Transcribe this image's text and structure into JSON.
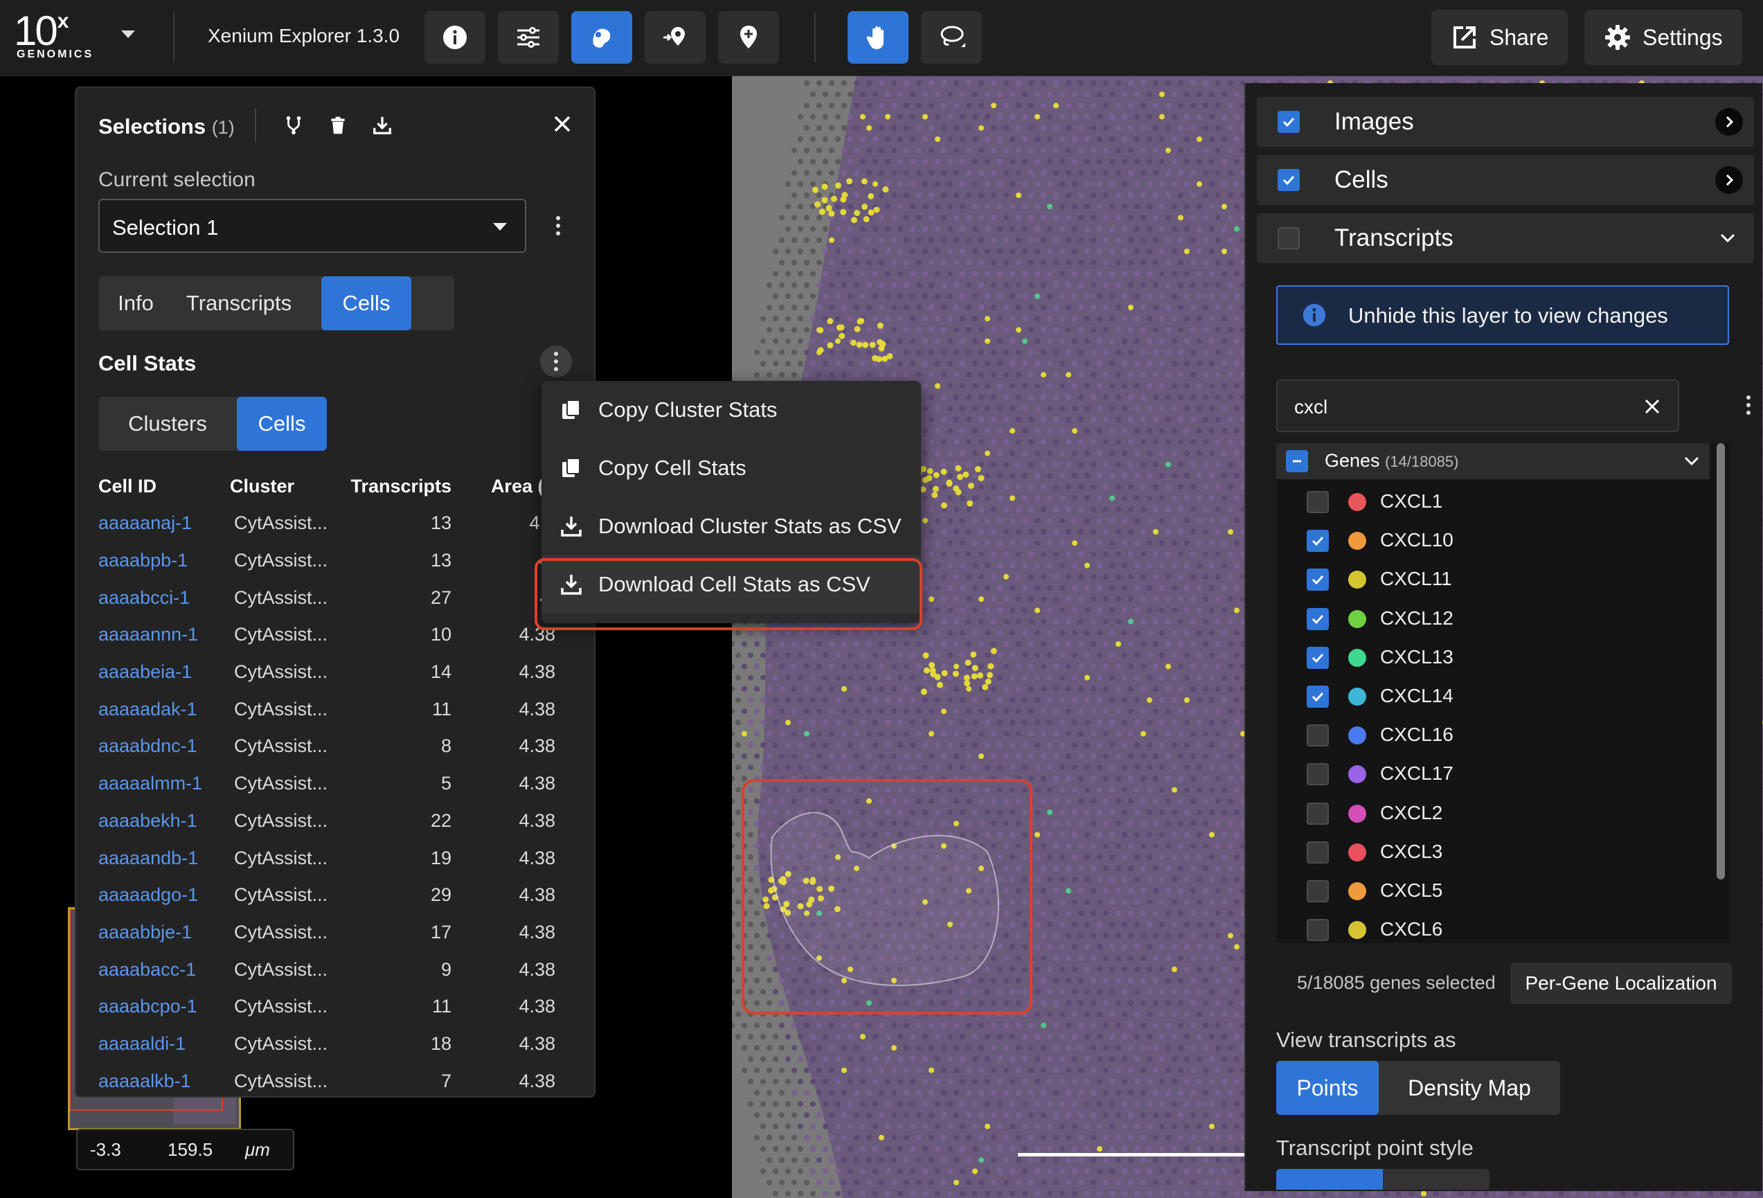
{
  "app": {
    "logo_main": "10",
    "logo_sup": "x",
    "logo_sub": "GENOMICS",
    "title": "Xenium Explorer 1.3.0",
    "share_label": "Share",
    "settings_label": "Settings"
  },
  "colors": {
    "accent": "#2f75d8",
    "highlight": "#d9412b",
    "link": "#5a96ee",
    "map_bg": "#7a7a7a"
  },
  "selections": {
    "title": "Selections",
    "count": "(1)",
    "current_label": "Current selection",
    "current_value": "Selection 1",
    "tabs": [
      {
        "label": "Info",
        "active": false
      },
      {
        "label": "Transcripts",
        "active": false
      },
      {
        "label": "Cells",
        "active": true
      }
    ],
    "cell_stats_title": "Cell Stats",
    "stat_tabs": [
      {
        "label": "Clusters",
        "active": false
      },
      {
        "label": "Cells",
        "active": true
      }
    ],
    "columns": [
      "Cell ID",
      "Cluster",
      "Transcripts",
      "Area (μ"
    ],
    "rows": [
      {
        "id": "aaaaanaj-1",
        "cluster": "CytAssist...",
        "transcripts": "13",
        "area": "4.3"
      },
      {
        "id": "aaaabpb-1",
        "cluster": "CytAssist...",
        "transcripts": "13",
        "area": "4."
      },
      {
        "id": "aaaabcci-1",
        "cluster": "CytAssist...",
        "transcripts": "27",
        "area": "4."
      },
      {
        "id": "aaaaannn-1",
        "cluster": "CytAssist...",
        "transcripts": "10",
        "area": "4.38"
      },
      {
        "id": "aaaabeia-1",
        "cluster": "CytAssist...",
        "transcripts": "14",
        "area": "4.38"
      },
      {
        "id": "aaaaadak-1",
        "cluster": "CytAssist...",
        "transcripts": "11",
        "area": "4.38"
      },
      {
        "id": "aaaabdnc-1",
        "cluster": "CytAssist...",
        "transcripts": "8",
        "area": "4.38"
      },
      {
        "id": "aaaaalmm-1",
        "cluster": "CytAssist...",
        "transcripts": "5",
        "area": "4.38"
      },
      {
        "id": "aaaabekh-1",
        "cluster": "CytAssist...",
        "transcripts": "22",
        "area": "4.38"
      },
      {
        "id": "aaaaandb-1",
        "cluster": "CytAssist...",
        "transcripts": "19",
        "area": "4.38"
      },
      {
        "id": "aaaaadgo-1",
        "cluster": "CytAssist...",
        "transcripts": "29",
        "area": "4.38"
      },
      {
        "id": "aaaabbje-1",
        "cluster": "CytAssist...",
        "transcripts": "17",
        "area": "4.38"
      },
      {
        "id": "aaaabacc-1",
        "cluster": "CytAssist...",
        "transcripts": "9",
        "area": "4.38"
      },
      {
        "id": "aaaabcpo-1",
        "cluster": "CytAssist...",
        "transcripts": "11",
        "area": "4.38"
      },
      {
        "id": "aaaaaldi-1",
        "cluster": "CytAssist...",
        "transcripts": "18",
        "area": "4.38"
      },
      {
        "id": "aaaaalkb-1",
        "cluster": "CytAssist...",
        "transcripts": "7",
        "area": "4.38"
      }
    ]
  },
  "context_menu": {
    "items": [
      {
        "label": "Copy Cluster Stats",
        "icon": "copy-icon"
      },
      {
        "label": "Copy Cell Stats",
        "icon": "copy-icon"
      },
      {
        "label": "Download Cluster Stats as CSV",
        "icon": "download-icon"
      },
      {
        "label": "Download Cell Stats as CSV",
        "icon": "download-icon",
        "highlighted": true
      }
    ]
  },
  "coords": {
    "x": "-3.3",
    "y": "159.5",
    "unit": "μm"
  },
  "layers": {
    "items": [
      {
        "label": "Images",
        "checked": true
      },
      {
        "label": "Cells",
        "checked": true
      },
      {
        "label": "Transcripts",
        "checked": false
      }
    ],
    "info_banner": "Unhide this layer to view changes",
    "search_value": "cxcl",
    "genes_header": "Genes",
    "genes_count": "(14/18085)",
    "genes": [
      {
        "name": "CXCL1",
        "checked": false,
        "color": "#e8575a"
      },
      {
        "name": "CXCL10",
        "checked": true,
        "color": "#ef9a3c"
      },
      {
        "name": "CXCL11",
        "checked": true,
        "color": "#d6c532"
      },
      {
        "name": "CXCL12",
        "checked": true,
        "color": "#6fd142"
      },
      {
        "name": "CXCL13",
        "checked": true,
        "color": "#3fd88e"
      },
      {
        "name": "CXCL14",
        "checked": true,
        "color": "#3fb6d8"
      },
      {
        "name": "CXCL16",
        "checked": false,
        "color": "#4a7bf0"
      },
      {
        "name": "CXCL17",
        "checked": false,
        "color": "#9a63e8"
      },
      {
        "name": "CXCL2",
        "checked": false,
        "color": "#d450b8"
      },
      {
        "name": "CXCL3",
        "checked": false,
        "color": "#e8505e"
      },
      {
        "name": "CXCL5",
        "checked": false,
        "color": "#ef9a3c"
      },
      {
        "name": "CXCL6",
        "checked": false,
        "color": "#d6c532"
      }
    ],
    "genes_selected": "5/18085 genes selected",
    "per_gene_button": "Per-Gene Localization",
    "view_as_label": "View transcripts as",
    "view_as_options": [
      {
        "label": "Points",
        "active": true
      },
      {
        "label": "Density Map",
        "active": false
      }
    ],
    "point_style_label": "Transcript point style"
  }
}
